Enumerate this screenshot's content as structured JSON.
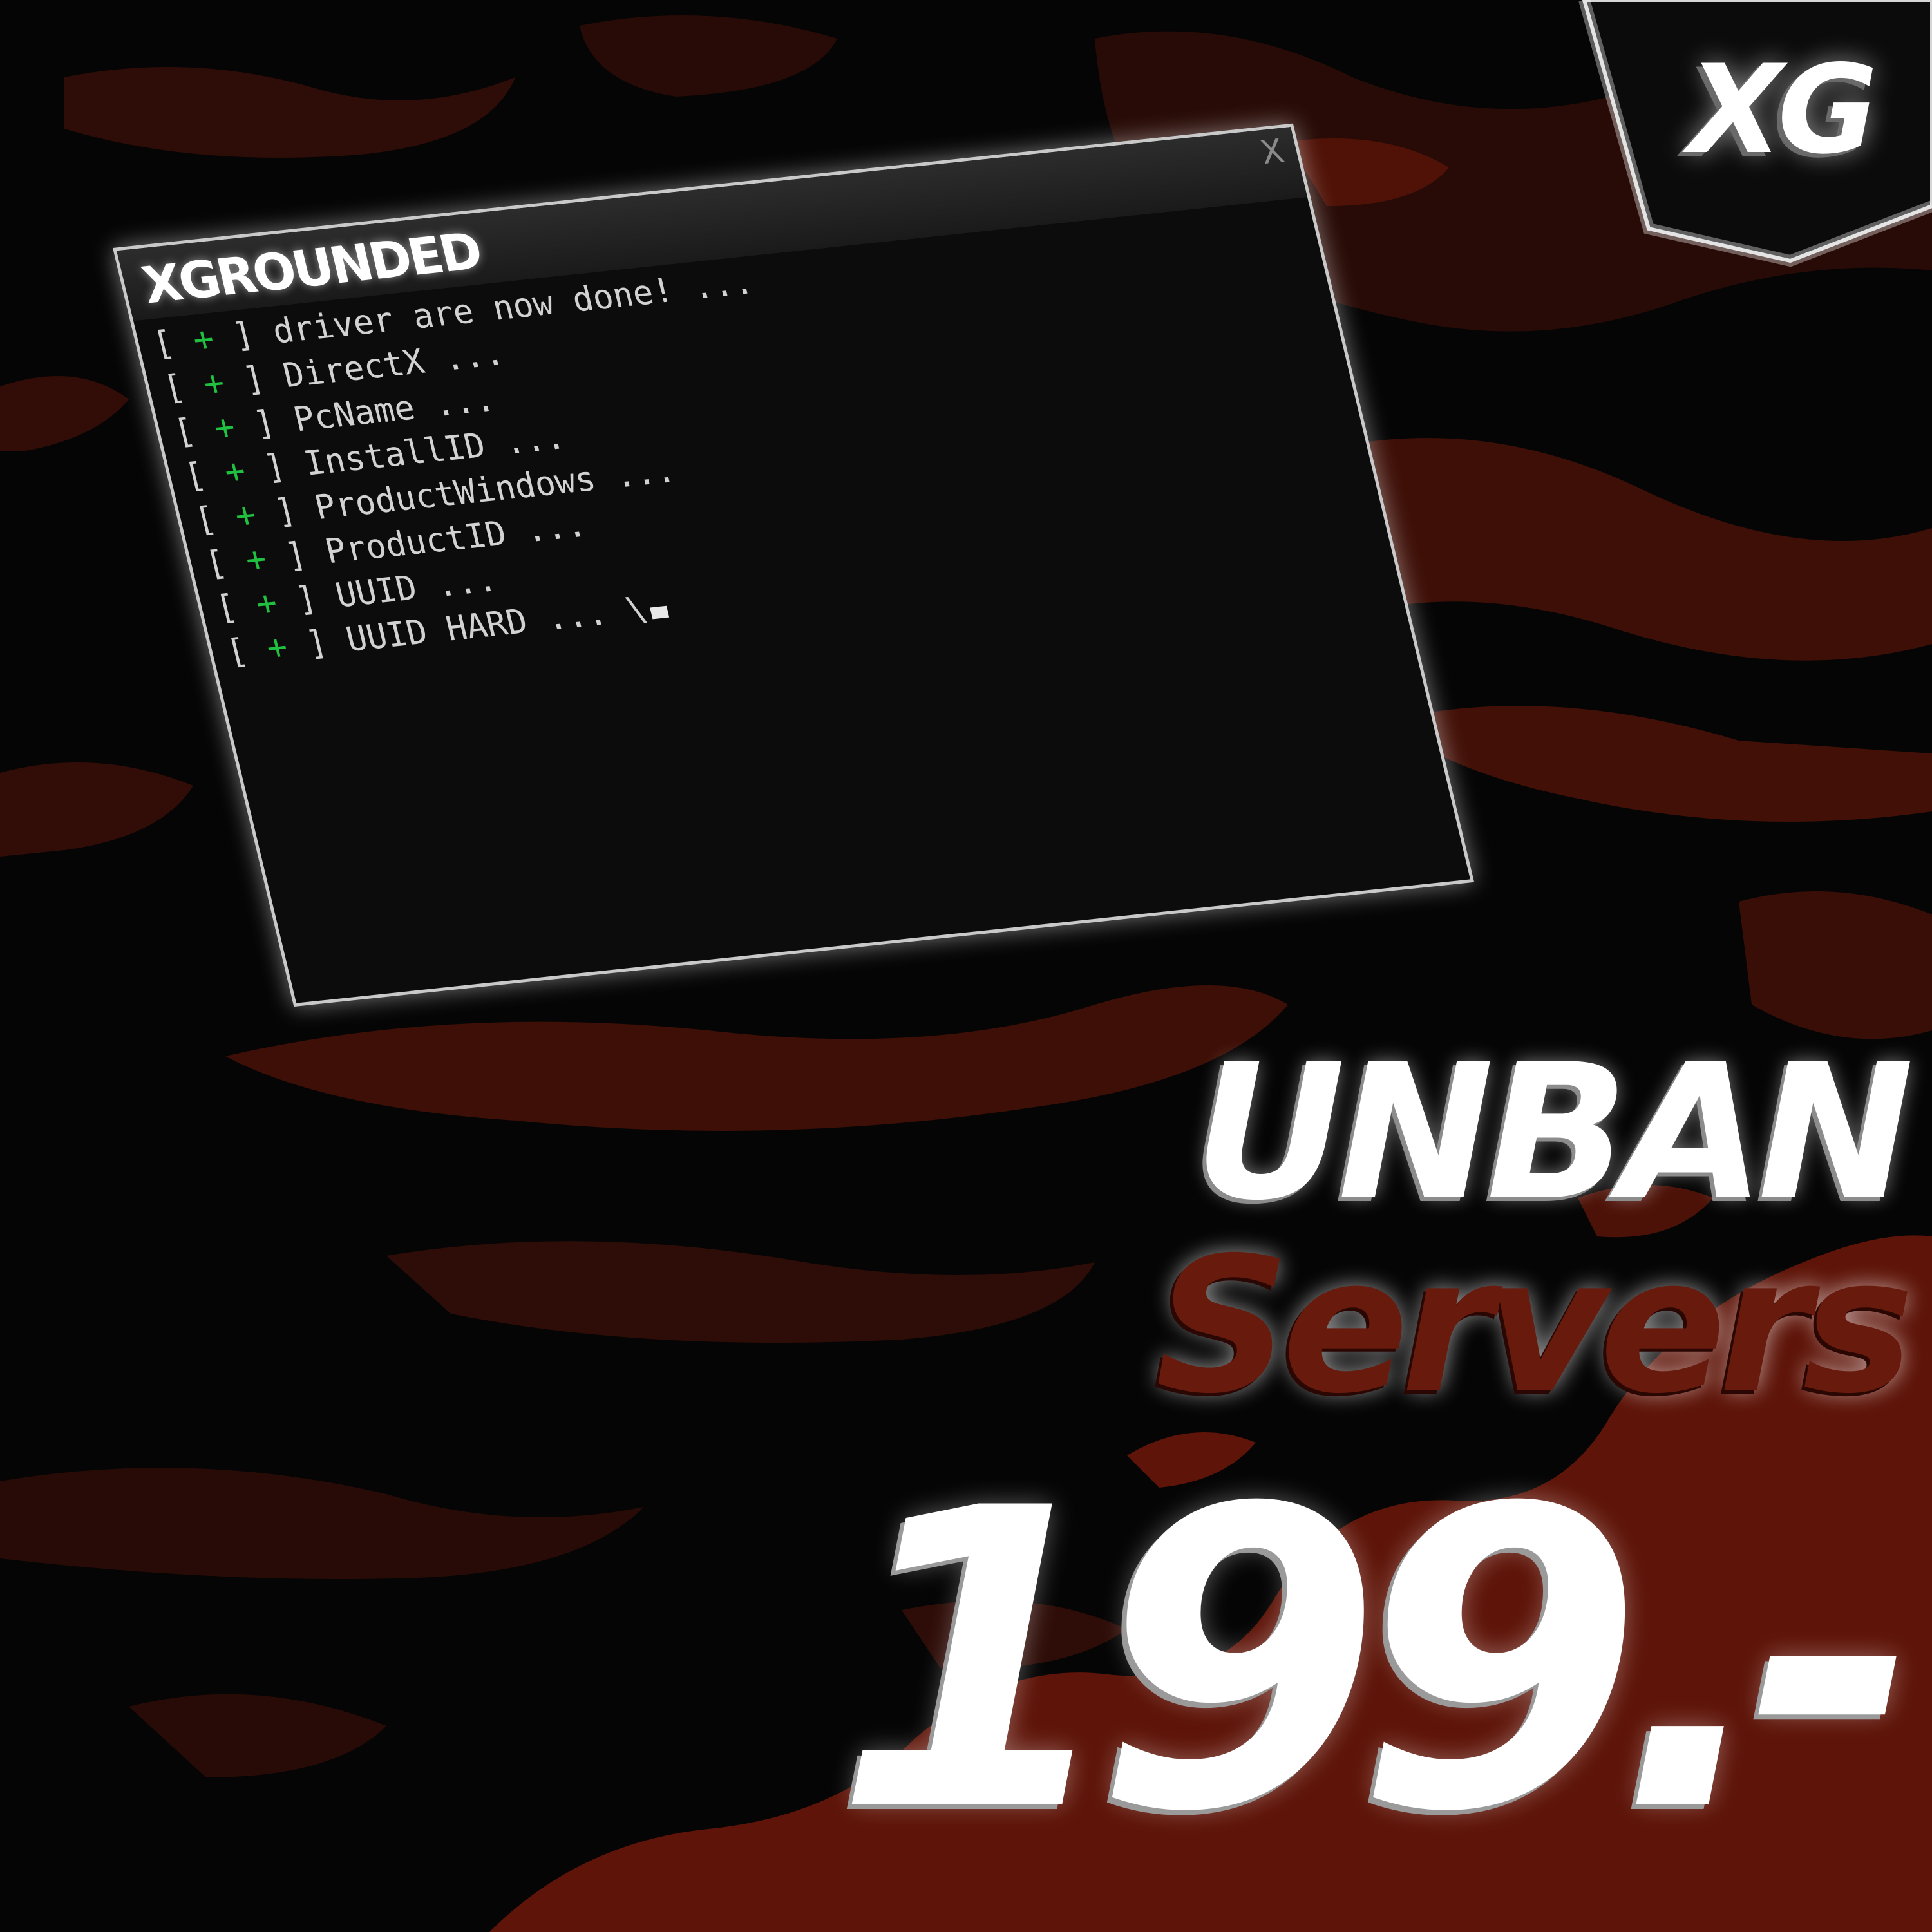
{
  "brand": {
    "badge_text": "XG"
  },
  "terminal": {
    "title": "XGROUNDED",
    "close_label": "X",
    "lines": [
      {
        "status": "+",
        "text": "driver are now done! ..."
      },
      {
        "status": "+",
        "text": "DirectX ..."
      },
      {
        "status": "+",
        "text": "PcName ..."
      },
      {
        "status": "+",
        "text": "InstallID ..."
      },
      {
        "status": "+",
        "text": "ProductWindows ..."
      },
      {
        "status": "+",
        "text": "ProductID ..."
      },
      {
        "status": "+",
        "text": "UUID ..."
      },
      {
        "status": "+",
        "text": "UUID HARD ... \\"
      }
    ]
  },
  "promo": {
    "headline": "UNBAN",
    "subheadline": "Servers",
    "price": "199.-"
  },
  "colors": {
    "background": "#050505",
    "splatter_red": "#6b1709",
    "blob_red": "#5e1408",
    "status_green": "#20c040",
    "terminal_bg": "#0c0c0c"
  },
  "icons": {
    "close": "close-icon",
    "cursor": "text-cursor-icon"
  }
}
